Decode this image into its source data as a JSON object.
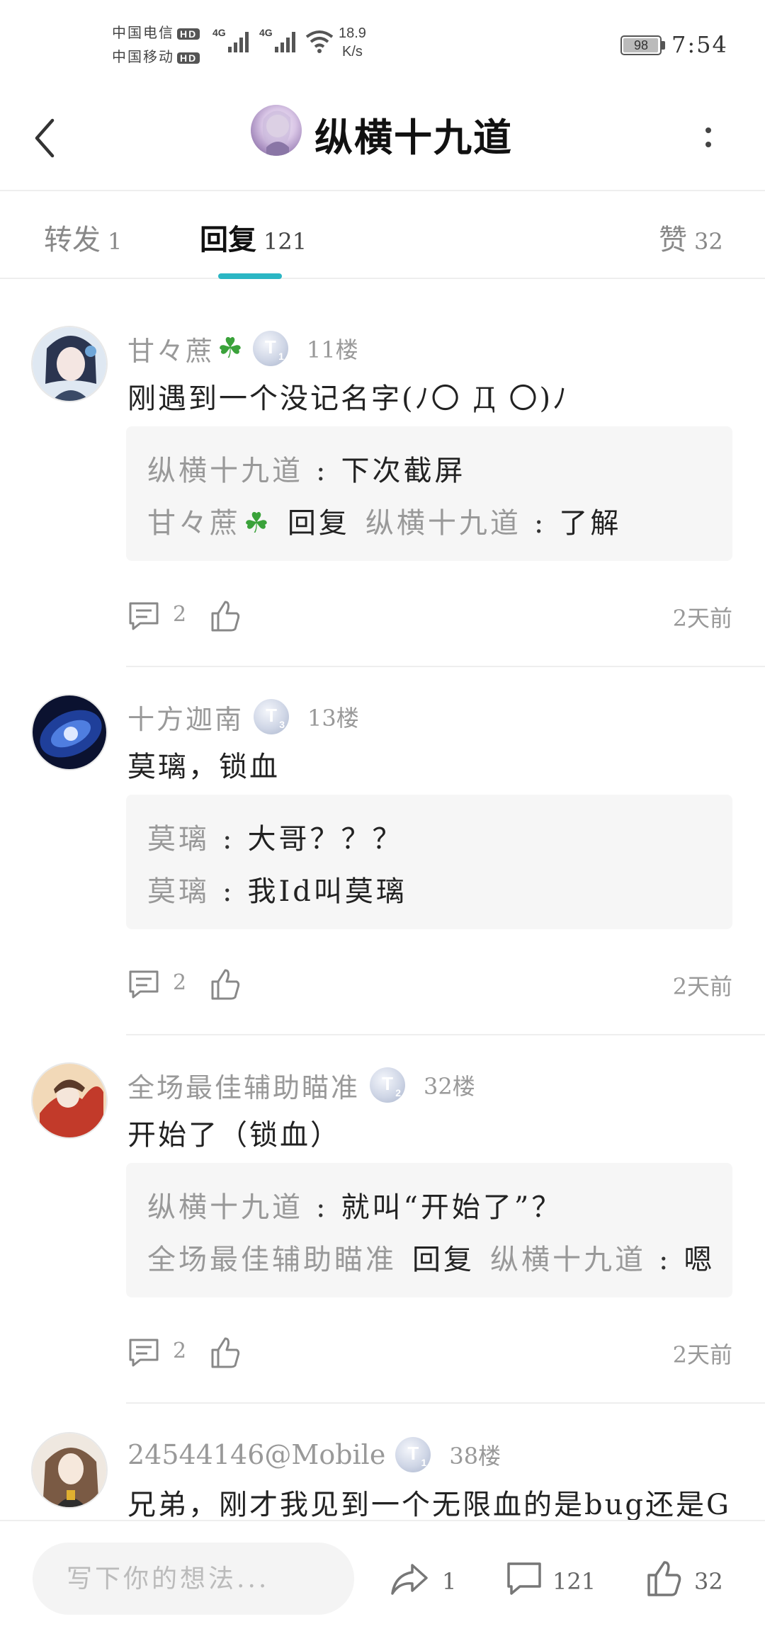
{
  "status_bar": {
    "carrier1": "中国电信",
    "carrier2": "中国移动",
    "hd": "HD",
    "signal1": "4G",
    "signal2": "4G",
    "speed_value": "18.9",
    "speed_unit": "K/s",
    "battery": "98",
    "time": "7:54"
  },
  "header": {
    "title": "纵横十九道",
    "back_icon": "chevron-left-icon",
    "more_icon": "more-vertical-icon"
  },
  "tabs": [
    {
      "label": "转发",
      "count": "1",
      "active": false
    },
    {
      "label": "回复",
      "count": "121",
      "active": true
    },
    {
      "label": "赞",
      "count": "32",
      "active": false
    }
  ],
  "accent_color": "#2bb6c4",
  "posts": [
    {
      "username": "甘々蔗",
      "clover": "☘",
      "level": "T",
      "level_sub": "1",
      "floor": "11楼",
      "content": "刚遇到一个没记名字(ﾉ〇 Д 〇)ﾉ",
      "quotes": [
        {
          "name": "纵横十九道",
          "sep": ":",
          "text": "下次截屏"
        },
        {
          "name": "甘々蔗",
          "clover": "☘",
          "reply": "回复",
          "target": "纵横十九道",
          "sep": ":",
          "text": "了解"
        }
      ],
      "reply_count": "2",
      "time": "2天前"
    },
    {
      "username": "十方迦南",
      "level": "T",
      "level_sub": "3",
      "floor": "13楼",
      "content": "莫璃，锁血",
      "quotes": [
        {
          "name": "莫璃",
          "sep": ":",
          "text": "大哥？？？"
        },
        {
          "name": "莫璃",
          "sep": ":",
          "text": "我Id叫莫璃"
        }
      ],
      "reply_count": "2",
      "time": "2天前"
    },
    {
      "username": "全场最佳辅助瞄准",
      "level": "T",
      "level_sub": "2",
      "floor": "32楼",
      "content": "开始了（锁血）",
      "quotes": [
        {
          "name": "纵横十九道",
          "sep": ":",
          "text": "就叫“开始了”？"
        },
        {
          "name": "全场最佳辅助瞄准",
          "reply": "回复",
          "target": "纵横十九道",
          "sep": ":",
          "text": "嗯"
        }
      ],
      "reply_count": "2",
      "time": "2天前"
    },
    {
      "username": "24544146@Mobile",
      "level": "T",
      "level_sub": "1",
      "floor": "38楼",
      "content": "兄弟，刚才我见到一个无限血的是bug还是G"
    }
  ],
  "bottom_bar": {
    "input_placeholder": "写下你的想法...",
    "forward_count": "1",
    "reply_count": "121",
    "like_count": "32"
  }
}
